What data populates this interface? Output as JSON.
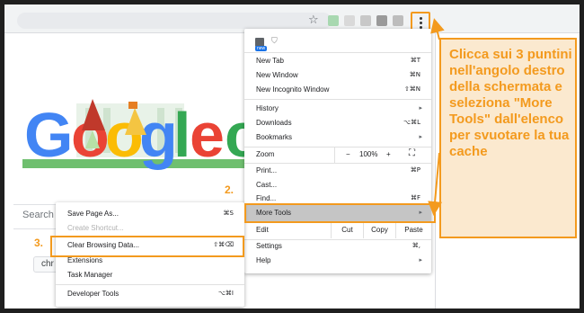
{
  "browser": {
    "menu_label": "⋮",
    "star_icon": "star-icon"
  },
  "page": {
    "search_placeholder": "Search G",
    "chip_label": "chr"
  },
  "chrome_menu": {
    "new_tab": {
      "label": "New Tab",
      "shortcut": "⌘T"
    },
    "new_window": {
      "label": "New Window",
      "shortcut": "⌘N"
    },
    "new_incognito": {
      "label": "New Incognito Window",
      "shortcut": "⇧⌘N"
    },
    "history": {
      "label": "History"
    },
    "downloads": {
      "label": "Downloads",
      "shortcut": "⌥⌘L"
    },
    "bookmarks": {
      "label": "Bookmarks"
    },
    "zoom": {
      "label": "Zoom",
      "minus": "−",
      "value": "100%",
      "plus": "+",
      "fullscreen": "⛶"
    },
    "print": {
      "label": "Print...",
      "shortcut": "⌘P"
    },
    "cast": {
      "label": "Cast..."
    },
    "find": {
      "label": "Find...",
      "shortcut": "⌘F"
    },
    "more_tools": {
      "label": "More Tools"
    },
    "edit": {
      "label": "Edit",
      "cut": "Cut",
      "copy": "Copy",
      "paste": "Paste"
    },
    "settings": {
      "label": "Settings",
      "shortcut": "⌘,"
    },
    "help": {
      "label": "Help"
    },
    "top_badge": "new"
  },
  "more_tools_menu": {
    "save_page": {
      "label": "Save Page As...",
      "shortcut": "⌘S"
    },
    "create_shortcut": {
      "label": "Create Shortcut..."
    },
    "clear_browsing": {
      "label": "Clear Browsing Data...",
      "shortcut": "⇧⌘⌫"
    },
    "extensions": {
      "label": "Extensions"
    },
    "task_manager": {
      "label": "Task Manager"
    },
    "developer_tools": {
      "label": "Developer Tools",
      "shortcut": "⌥⌘I"
    }
  },
  "annotations": {
    "step2": "2.",
    "step3": "3.",
    "callout": "Clicca sui 3 puntini nell'angolo destro della schermata e seleziona \"More Tools\" dall'elenco per svuotare la tua cache"
  },
  "colors": {
    "accent": "#f39a1e",
    "callout_bg": "#fbe9cf"
  }
}
